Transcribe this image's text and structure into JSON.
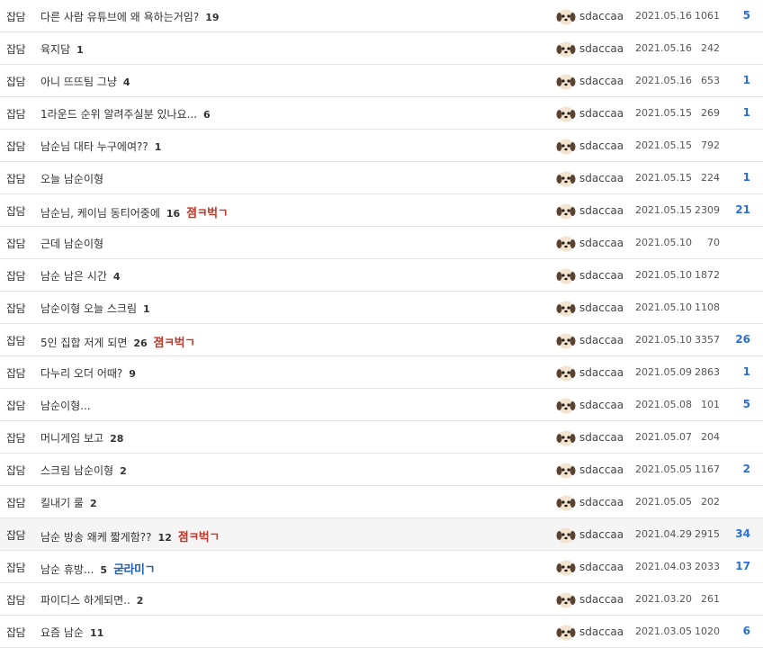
{
  "posts": [
    {
      "category": "잡담",
      "title": "다른 사람 유튜브에 왜 욕하는거임?",
      "comments": "19",
      "badge": "",
      "badge_color": "",
      "author": "sdaccaa",
      "date": "2021.05.16",
      "views": "1061",
      "likes": "5"
    },
    {
      "category": "잡담",
      "title": "육지담",
      "comments": "1",
      "badge": "",
      "badge_color": "",
      "author": "sdaccaa",
      "date": "2021.05.16",
      "views": "242",
      "likes": ""
    },
    {
      "category": "잡담",
      "title": "아니 뜨뜨팀 그냥",
      "comments": "4",
      "badge": "",
      "badge_color": "",
      "author": "sdaccaa",
      "date": "2021.05.16",
      "views": "653",
      "likes": "1"
    },
    {
      "category": "잡담",
      "title": "1라운드 순위 알려주실분 있나요...",
      "comments": "6",
      "badge": "",
      "badge_color": "",
      "author": "sdaccaa",
      "date": "2021.05.15",
      "views": "269",
      "likes": "1"
    },
    {
      "category": "잡담",
      "title": "남순님 대타 누구에여??",
      "comments": "1",
      "badge": "",
      "badge_color": "",
      "author": "sdaccaa",
      "date": "2021.05.15",
      "views": "792",
      "likes": ""
    },
    {
      "category": "잡담",
      "title": "오늘 남순이형",
      "comments": "",
      "badge": "",
      "badge_color": "",
      "author": "sdaccaa",
      "date": "2021.05.15",
      "views": "224",
      "likes": "1"
    },
    {
      "category": "잡담",
      "title": "남순님, 케이님 동티어중에",
      "comments": "16",
      "badge": "졈ㅋ벅ㄱ",
      "badge_color": "red",
      "author": "sdaccaa",
      "date": "2021.05.15",
      "views": "2309",
      "likes": "21"
    },
    {
      "category": "잡담",
      "title": "근데 남순이형",
      "comments": "",
      "badge": "",
      "badge_color": "",
      "author": "sdaccaa",
      "date": "2021.05.10",
      "views": "70",
      "likes": ""
    },
    {
      "category": "잡담",
      "title": "남순 남은 시간",
      "comments": "4",
      "badge": "",
      "badge_color": "",
      "author": "sdaccaa",
      "date": "2021.05.10",
      "views": "1872",
      "likes": ""
    },
    {
      "category": "잡담",
      "title": "남순이형 오늘 스크림",
      "comments": "1",
      "badge": "",
      "badge_color": "",
      "author": "sdaccaa",
      "date": "2021.05.10",
      "views": "1108",
      "likes": ""
    },
    {
      "category": "잡담",
      "title": "5인 집합 저게 되면",
      "comments": "26",
      "badge": "졈ㅋ벅ㄱ",
      "badge_color": "red",
      "author": "sdaccaa",
      "date": "2021.05.10",
      "views": "3357",
      "likes": "26"
    },
    {
      "category": "잡담",
      "title": "다누리 오더 어때?",
      "comments": "9",
      "badge": "",
      "badge_color": "",
      "author": "sdaccaa",
      "date": "2021.05.09",
      "views": "2863",
      "likes": "1"
    },
    {
      "category": "잡담",
      "title": "남순이형...",
      "comments": "",
      "badge": "",
      "badge_color": "",
      "author": "sdaccaa",
      "date": "2021.05.08",
      "views": "101",
      "likes": "5"
    },
    {
      "category": "잡담",
      "title": "머니게임 보고",
      "comments": "28",
      "badge": "",
      "badge_color": "",
      "author": "sdaccaa",
      "date": "2021.05.07",
      "views": "204",
      "likes": ""
    },
    {
      "category": "잡담",
      "title": "스크림 남순이형",
      "comments": "2",
      "badge": "",
      "badge_color": "",
      "author": "sdaccaa",
      "date": "2021.05.05",
      "views": "1167",
      "likes": "2"
    },
    {
      "category": "잡담",
      "title": "킬내기 룰",
      "comments": "2",
      "badge": "",
      "badge_color": "",
      "author": "sdaccaa",
      "date": "2021.05.05",
      "views": "202",
      "likes": ""
    },
    {
      "category": "잡담",
      "title": "남순 방송 왜케 짧게함??",
      "comments": "12",
      "badge": "졈ㅋ벅ㄱ",
      "badge_color": "red",
      "author": "sdaccaa",
      "date": "2021.04.29",
      "views": "2915",
      "likes": "34",
      "highlight": true
    },
    {
      "category": "잡담",
      "title": "남순 휴방...",
      "comments": "5",
      "badge": "굳라미ㄱ",
      "badge_color": "blue",
      "author": "sdaccaa",
      "date": "2021.04.03",
      "views": "2033",
      "likes": "17"
    },
    {
      "category": "잡담",
      "title": "파이디스 하게되면..",
      "comments": "2",
      "badge": "",
      "badge_color": "",
      "author": "sdaccaa",
      "date": "2021.03.20",
      "views": "261",
      "likes": ""
    },
    {
      "category": "잡담",
      "title": "요즘 남순",
      "comments": "11",
      "badge": "",
      "badge_color": "",
      "author": "sdaccaa",
      "date": "2021.03.05",
      "views": "1020",
      "likes": "6"
    }
  ],
  "avatar_icon": "puppy-avatar-icon"
}
